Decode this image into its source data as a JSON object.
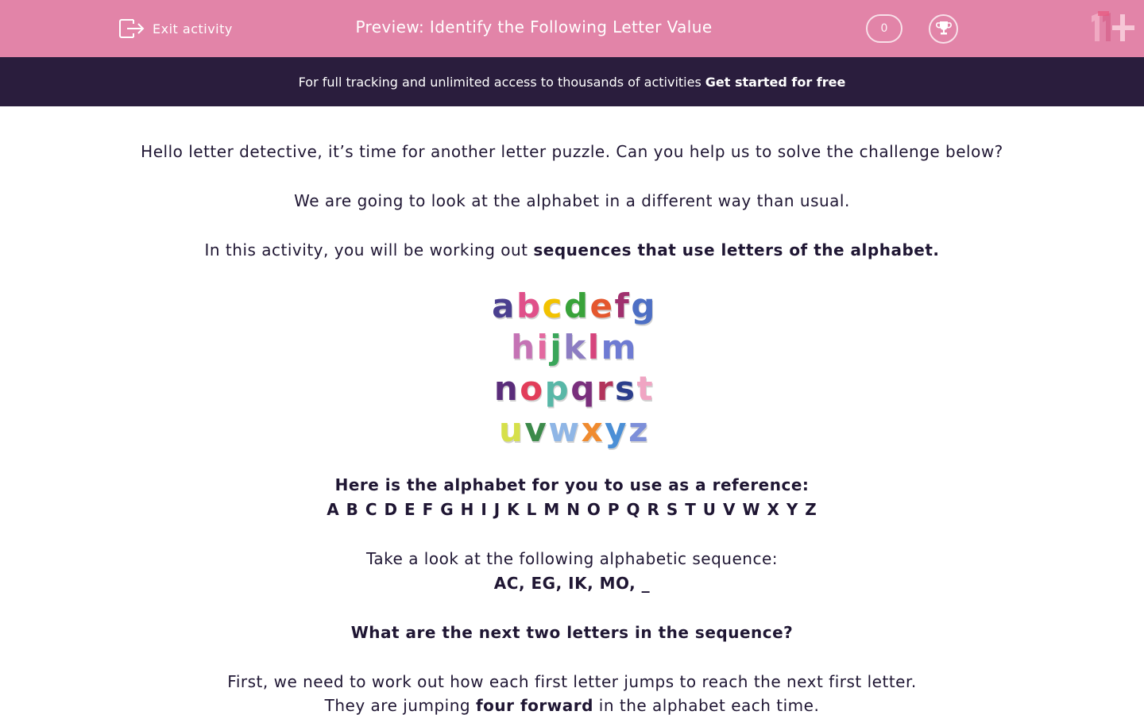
{
  "header": {
    "exit_label": "Exit activity",
    "title": "Preview: Identify the Following Letter Value",
    "score": "0",
    "background_color": "#e284a8"
  },
  "banner": {
    "text": "For full tracking and unlimited access to thousands of activities",
    "cta": "Get started for free",
    "background_color": "#2a1d3d"
  },
  "content": {
    "intro": "Hello letter detective, it’s time for another letter puzzle. Can you help us to solve the challenge below?",
    "line2": "We are going to look at the alphabet in a different way than usual.",
    "line3_plain": "In this activity, you will be working out",
    "line3_bold": "sequences that use letters of the alphabet.",
    "image": {
      "rows": [
        [
          "a",
          "b",
          "c",
          "d",
          "e",
          "f",
          "g"
        ],
        [
          "h",
          "i",
          "j",
          "k",
          "l",
          "m"
        ],
        [
          "n",
          "o",
          "p",
          "q",
          "r",
          "s",
          "t"
        ],
        [
          "u",
          "v",
          "w",
          "x",
          "y",
          "z"
        ]
      ],
      "colors": [
        [
          "#4a3f8f",
          "#e0508a",
          "#f2c200",
          "#39a33a",
          "#e4572e",
          "#a0306e",
          "#4d6fc4"
        ],
        [
          "#c573b5",
          "#e36aa0",
          "#3aa65a",
          "#8c7dc2",
          "#d6457d",
          "#6e7bd3"
        ],
        [
          "#5a2c7a",
          "#e23d5a",
          "#58b7a7",
          "#7a2f7d",
          "#b2335b",
          "#2c3e8c",
          "#f0a5c3"
        ],
        [
          "#d6e04a",
          "#3c8a4a",
          "#8fb6e6",
          "#f08b2f",
          "#4b8fd6",
          "#7d8fd9"
        ]
      ]
    },
    "reference_heading": "Here is the alphabet for you to use as a reference:",
    "alphabet": "A B C D E F G H I J K L M N O P Q R S T U V W X Y Z",
    "sequence_intro": "Take a look at the following alphabetic sequence:",
    "sequence": "AC, EG, IK, MO, _",
    "question": "What are the next two letters in the sequence?",
    "explanation1": "First, we need to work out how each first letter jumps to reach the next first letter.",
    "explanation2_start": "They are jumping",
    "explanation2_bold": "four forward",
    "explanation2_end": "in the alphabet each time."
  }
}
